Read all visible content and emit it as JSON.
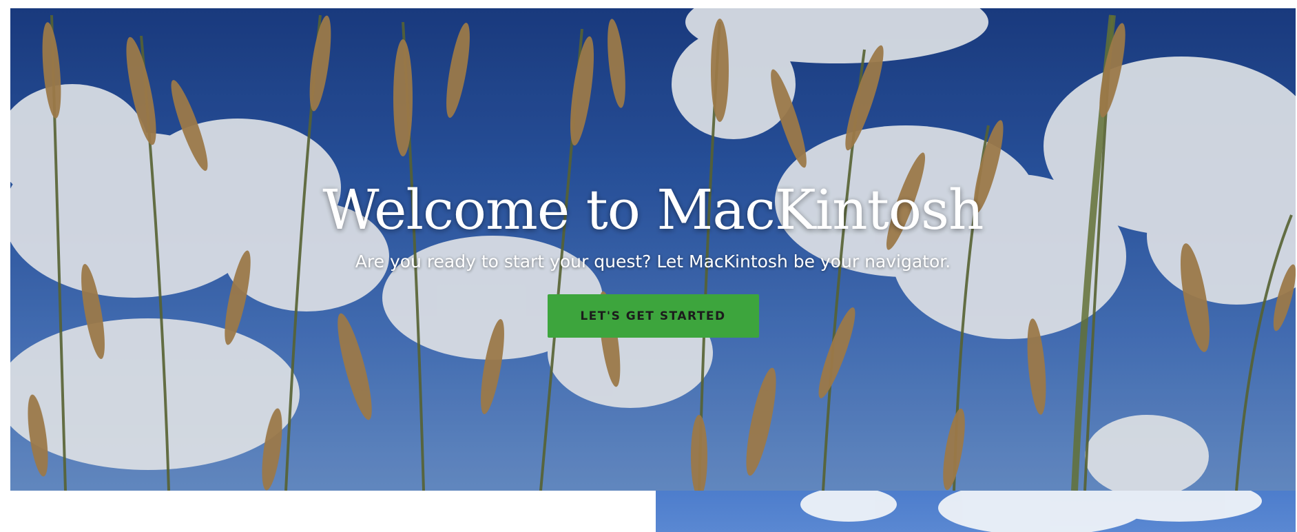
{
  "hero": {
    "title": "Welcome to MacKintosh",
    "subtitle": "Are you ready to start your quest? Let MacKintosh be your navigator.",
    "cta_label": "LET'S GET STARTED",
    "background": "sky-and-grass-photo"
  },
  "colors": {
    "sky": "#2b57a6",
    "cloud": "#f2f4f8",
    "grass": "#a57d45",
    "cta_background": "#3da53d",
    "cta_text": "#1c1c1c",
    "title_text": "#ffffff"
  },
  "lower_section": {
    "right_panel_background": "sky-photo"
  }
}
